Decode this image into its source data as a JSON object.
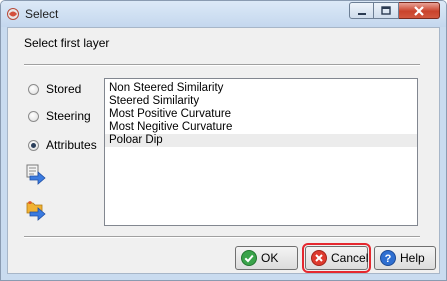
{
  "window": {
    "title": "Select"
  },
  "dialog": {
    "prompt": "Select first layer"
  },
  "radios": [
    {
      "label": "Stored",
      "checked": false
    },
    {
      "label": "Steering",
      "checked": false
    },
    {
      "label": "Attributes",
      "checked": true
    }
  ],
  "list": {
    "items": [
      "Non Steered Similarity",
      "Steered Similarity",
      "Most Positive Curvature",
      "Most Negitive Curvature",
      "Poloar Dip"
    ],
    "selected_index": 4
  },
  "buttons": {
    "ok_label": "OK",
    "cancel_label": "Cancel",
    "help_label": "Help"
  },
  "icons": {
    "title": "app-icon",
    "minimize": "minimize-icon",
    "maximize": "maximize-icon",
    "close": "close-icon",
    "tool1": "load-into-list-icon",
    "tool2": "load-file-icon",
    "ok": "check-icon",
    "cancel": "cancel-icon",
    "help": "help-icon"
  },
  "colors": {
    "cancel_highlight": "#e5282f",
    "close_button": "#c9432c",
    "selection": "#ececec"
  }
}
